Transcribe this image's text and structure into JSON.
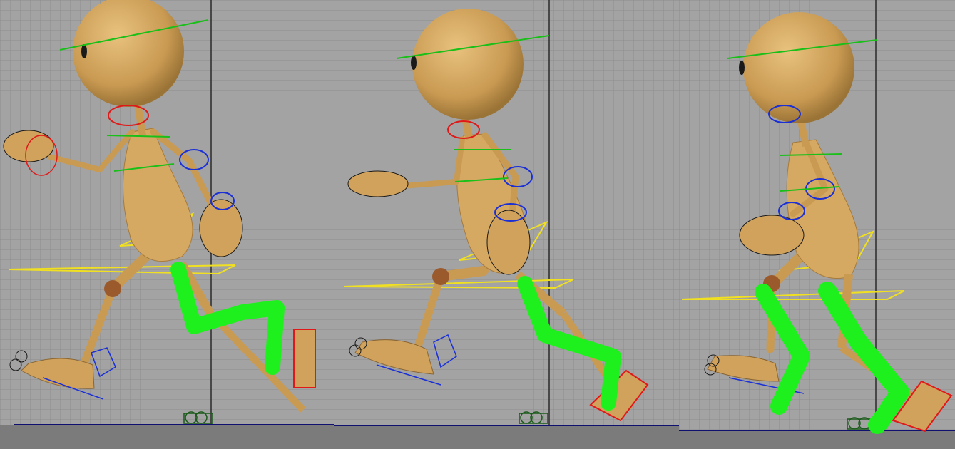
{
  "scene": {
    "panels": [
      {
        "frame": "left",
        "pose": "contact-forward-stride"
      },
      {
        "frame": "middle",
        "pose": "passing-down"
      },
      {
        "frame": "right",
        "pose": "passing-up"
      }
    ],
    "colors": {
      "grid_background": "#a3a3a3",
      "grid_line": "#8d8d8d",
      "grid_axis": "#2a2a2a",
      "ground": "#7b7b7b",
      "ground_line": "#101070",
      "body": "#d6a963",
      "body_shade": "#b88a45",
      "joint": "#9a5a2c",
      "ik_handle_red": "#e01818",
      "ik_handle_blue": "#1a2fd6",
      "control_green": "#18c018",
      "control_yellow": "#f0e020",
      "highlight_stroke": "#1ef01e",
      "hand_rig": "#1a1a1a"
    },
    "icons": [
      "character-rig-icon",
      "ik-control-icon",
      "joint-icon",
      "ground-marker-icon"
    ]
  }
}
